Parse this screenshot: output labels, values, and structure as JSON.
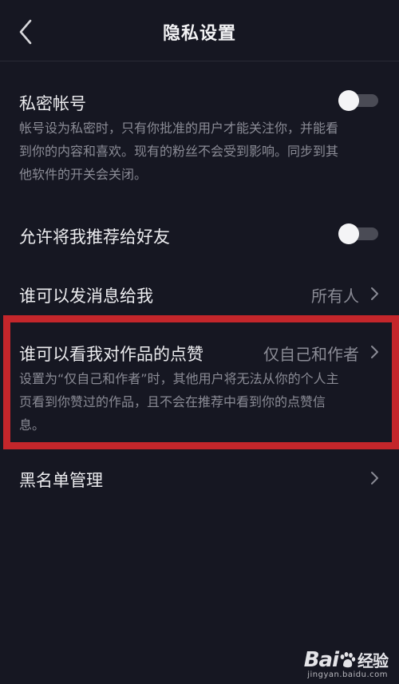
{
  "nav": {
    "title": "隐私设置",
    "back_icon": "chevron-left-icon"
  },
  "private_account": {
    "label": "私密帐号",
    "enabled": false,
    "description_lines": [
      "帐号设为私密时，只有你批准的用户才能关注你，并能看",
      "到你的内容和喜欢。现有的粉丝不会受到影响。同步到其",
      "他软件的开关会关闭。"
    ]
  },
  "recommend_to_friends": {
    "label": "允许将我推荐给好友",
    "enabled": false
  },
  "who_can_message": {
    "label": "谁可以发消息给我",
    "value": "所有人"
  },
  "who_can_see_likes": {
    "label": "谁可以看我对作品的点赞",
    "value": "仅自己和作者",
    "description_lines": [
      "设置为“仅自己和作者”时，其他用户将无法从你的个人主",
      "页看到你赞过的作品，且不会在推荐中看到你的点赞信",
      "息。"
    ]
  },
  "blacklist": {
    "label": "黑名单管理"
  },
  "watermark": {
    "brand": "Bai",
    "brand_suffix": "经验",
    "url": "jingyan.baidu.com"
  },
  "colors": {
    "background": "#161722",
    "highlight": "#c4262b",
    "secondary_text": "#8a8b95"
  }
}
